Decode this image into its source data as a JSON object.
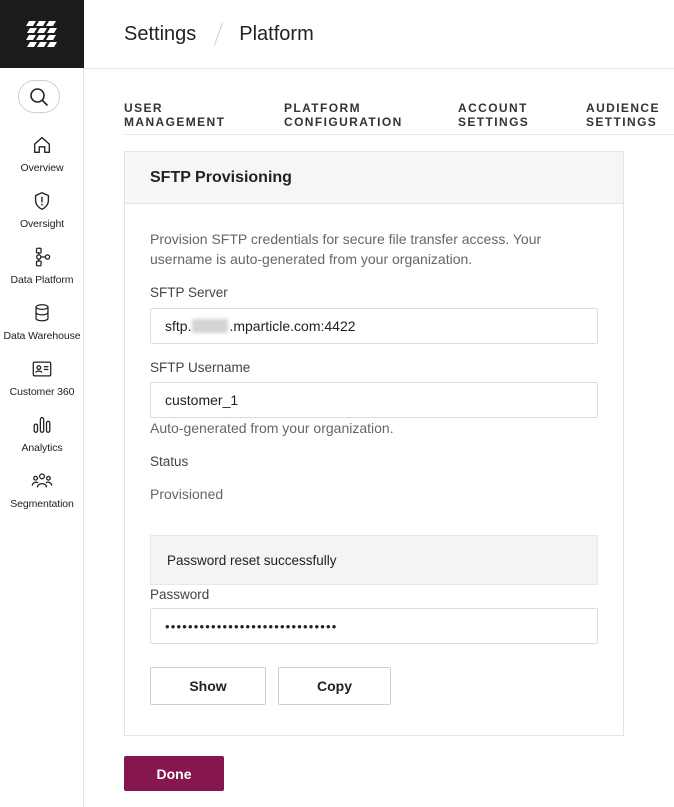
{
  "header": {
    "crumbs": [
      "Settings",
      "Platform"
    ]
  },
  "nav": {
    "items": [
      {
        "label": "Overview",
        "icon": "home-icon"
      },
      {
        "label": "Oversight",
        "icon": "shield-icon"
      },
      {
        "label": "Data Platform",
        "icon": "data-platform-icon"
      },
      {
        "label": "Data Warehouse",
        "icon": "database-icon"
      },
      {
        "label": "Customer 360",
        "icon": "id-card-icon"
      },
      {
        "label": "Analytics",
        "icon": "bar-chart-icon"
      },
      {
        "label": "Segmentation",
        "icon": "people-icon"
      }
    ]
  },
  "tabs": [
    {
      "line1": "USER",
      "line2": "MANAGEMENT"
    },
    {
      "line1": "PLATFORM",
      "line2": "CONFIGURATION"
    },
    {
      "line1": "ACCOUNT",
      "line2": "SETTINGS"
    },
    {
      "line1": "AUDIENCE",
      "line2": "SETTINGS"
    }
  ],
  "card": {
    "title": "SFTP Provisioning",
    "description": "Provision SFTP credentials for secure file transfer access. Your username is auto-generated from your organization.",
    "server_label": "SFTP Server",
    "server_prefix": "sftp.",
    "server_suffix": ".mparticle.com:4422",
    "username_label": "SFTP Username",
    "username_value": "customer_1",
    "username_helper": "Auto-generated from your organization.",
    "status_label": "Status",
    "status_value": "Provisioned",
    "notice": "Password reset successfully",
    "password_label": "Password",
    "password_value": "••••••••••••••••••••••••••••••",
    "show_label": "Show",
    "copy_label": "Copy"
  },
  "done_label": "Done",
  "colors": {
    "accent": "#85164f",
    "logo_bg": "#1c1c1c"
  }
}
